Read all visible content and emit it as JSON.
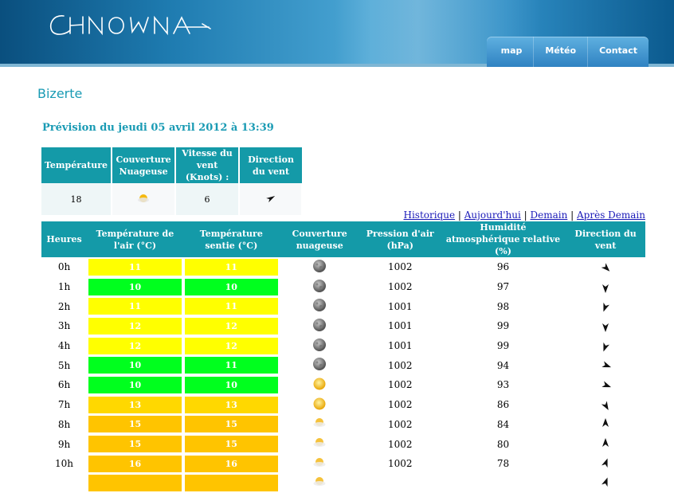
{
  "site": {
    "logo_text": "CHNOUNA"
  },
  "nav": [
    "map",
    "Météo",
    "Contact"
  ],
  "city": "Bizerte",
  "subtitle": "Prévision du jeudi 05 avril 2012 à 13:39",
  "current": {
    "headers": [
      "Température",
      "Couverture Nuageuse",
      "Vitesse du vent (Knots) :",
      "Direction du vent"
    ],
    "temperature": "18",
    "cloud_icon": "partly-cloudy-sun-icon",
    "wind_speed": "6",
    "wind_direction_icon": "wind-arrow-icon"
  },
  "links": [
    "Historique",
    "Aujourd'hui",
    "Demain",
    "Après Demain"
  ],
  "forecast": {
    "headers": [
      "Heures",
      "Température de l'air (°C)",
      "Température sentie (°C)",
      "Couverture nuageuse",
      "Pression d'air (hPa)",
      "Humidité atmosphérique relative (%)",
      "Direction du vent"
    ],
    "colors": {
      "yellow": "#ffff00",
      "green": "#00ff1e",
      "gold": "#ffd800",
      "orange": "#ffc400",
      "header": "#149aa8",
      "title": "#1a9bb4"
    },
    "rows": [
      {
        "hour": "0h",
        "air": "11",
        "air_color": "yellow",
        "felt": "11",
        "felt_color": "yellow",
        "cloud": "moon-icon",
        "pressure": "1002",
        "humidity": "96",
        "wind_deg": 135
      },
      {
        "hour": "1h",
        "air": "10",
        "air_color": "green",
        "felt": "10",
        "felt_color": "green",
        "cloud": "moon-icon",
        "pressure": "1002",
        "humidity": "97",
        "wind_deg": 180
      },
      {
        "hour": "2h",
        "air": "11",
        "air_color": "yellow",
        "felt": "11",
        "felt_color": "yellow",
        "cloud": "moon-icon",
        "pressure": "1001",
        "humidity": "98",
        "wind_deg": 200
      },
      {
        "hour": "3h",
        "air": "12",
        "air_color": "yellow",
        "felt": "12",
        "felt_color": "yellow",
        "cloud": "moon-icon",
        "pressure": "1001",
        "humidity": "99",
        "wind_deg": 180
      },
      {
        "hour": "4h",
        "air": "12",
        "air_color": "yellow",
        "felt": "12",
        "felt_color": "yellow",
        "cloud": "moon-icon",
        "pressure": "1001",
        "humidity": "99",
        "wind_deg": 200
      },
      {
        "hour": "5h",
        "air": "10",
        "air_color": "green",
        "felt": "11",
        "felt_color": "green",
        "cloud": "moon-icon",
        "pressure": "1002",
        "humidity": "94",
        "wind_deg": 110
      },
      {
        "hour": "6h",
        "air": "10",
        "air_color": "green",
        "felt": "10",
        "felt_color": "green",
        "cloud": "sun-icon",
        "pressure": "1002",
        "humidity": "93",
        "wind_deg": 110
      },
      {
        "hour": "7h",
        "air": "13",
        "air_color": "gold",
        "felt": "13",
        "felt_color": "gold",
        "cloud": "sun-icon",
        "pressure": "1002",
        "humidity": "86",
        "wind_deg": 150
      },
      {
        "hour": "8h",
        "air": "15",
        "air_color": "orange",
        "felt": "15",
        "felt_color": "orange",
        "cloud": "partly-cloudy-sun-icon",
        "pressure": "1002",
        "humidity": "84",
        "wind_deg": 0
      },
      {
        "hour": "9h",
        "air": "15",
        "air_color": "orange",
        "felt": "15",
        "felt_color": "orange",
        "cloud": "partly-cloudy-sun-icon",
        "pressure": "1002",
        "humidity": "80",
        "wind_deg": 0
      },
      {
        "hour": "10h",
        "air": "16",
        "air_color": "orange",
        "felt": "16",
        "felt_color": "orange",
        "cloud": "partly-cloudy-sun-icon",
        "pressure": "1002",
        "humidity": "78",
        "wind_deg": 20
      },
      {
        "hour": "",
        "air": "",
        "air_color": "orange",
        "felt": "",
        "felt_color": "orange",
        "cloud": "partly-cloudy-sun-icon",
        "pressure": "",
        "humidity": "",
        "wind_deg": 20
      }
    ]
  }
}
